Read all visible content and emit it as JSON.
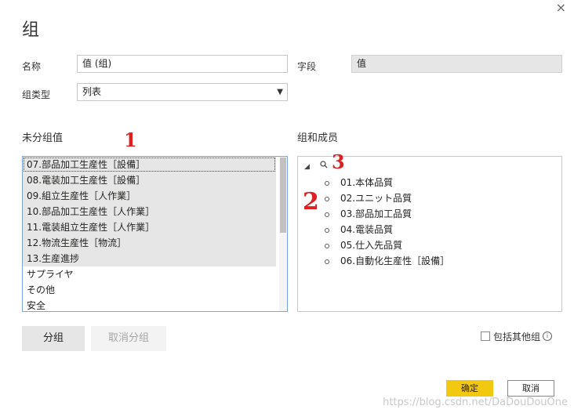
{
  "dialog": {
    "title": "组",
    "close_glyph": "×"
  },
  "form": {
    "name_label": "名称",
    "name_value": "值 (组)",
    "field_label": "字段",
    "field_value": "值",
    "type_label": "组类型",
    "type_value": "列表"
  },
  "ungrouped": {
    "title": "未分组值",
    "items": [
      {
        "label": "07.部品加工生産性［設備］",
        "selected": true
      },
      {
        "label": "08.電装加工生産性［設備］",
        "selected": true
      },
      {
        "label": "09.組立生産性［人作業］",
        "selected": true
      },
      {
        "label": "10.部品加工生産性［人作業］",
        "selected": true
      },
      {
        "label": "11.電装組立生産性［人作業］",
        "selected": true
      },
      {
        "label": "12.物流生産性［物流］",
        "selected": true
      },
      {
        "label": "13.生産進捗",
        "selected": true
      },
      {
        "label": "サプライヤ",
        "selected": false
      },
      {
        "label": "その他",
        "selected": false
      },
      {
        "label": "安全",
        "selected": false
      }
    ]
  },
  "members": {
    "title": "组和成员",
    "items": [
      "01.本体品質",
      "02.ユニット品質",
      "03.部品加工品質",
      "04.電装品質",
      "05.仕入先品質",
      "06.自動化生産性［設備］"
    ]
  },
  "buttons": {
    "group": "分组",
    "ungroup": "取消分组",
    "ok": "确定",
    "cancel": "取消"
  },
  "include_other": {
    "label": "包括其他组",
    "checked": false
  },
  "annotations": {
    "one": "1",
    "two": "2",
    "three": "3"
  },
  "watermark": "https://blog.csdn.net/DaDouDouOne",
  "colors": {
    "accent_yellow": "#f2c811",
    "annotation_red": "#e02020",
    "list_selected": "#e6e6e6",
    "list_border": "#7aa7dd"
  },
  "icons": [
    "close-icon",
    "dropdown-arrow-icon",
    "expand-triangle-icon",
    "search-icon",
    "info-icon"
  ]
}
